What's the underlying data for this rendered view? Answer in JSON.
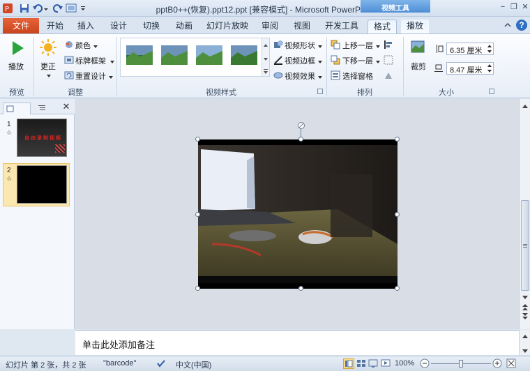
{
  "window": {
    "title": "pptB0++(恢复).ppt12.ppt [兼容模式] - Microsoft PowerPoint",
    "context_tab": "视频工具",
    "minimize": "−",
    "restore": "❐",
    "close": "✕"
  },
  "tabs": {
    "file": "文件",
    "items": [
      "开始",
      "插入",
      "设计",
      "切换",
      "动画",
      "幻灯片放映",
      "审阅",
      "视图",
      "开发工具",
      "格式",
      "播放"
    ],
    "help": "?"
  },
  "ribbon": {
    "preview": {
      "play": "播放",
      "label": "预览"
    },
    "adjust": {
      "correct": "更正",
      "color": "颜色",
      "poster": "标牌框架",
      "reset": "重置设计",
      "label": "调整"
    },
    "video_styles": {
      "shape": "视频形状",
      "border": "视频边框",
      "effects": "视频效果",
      "label": "视频样式"
    },
    "arrange": {
      "bring_forward": "上移一层",
      "send_backward": "下移一层",
      "selection_pane": "选择窗格",
      "label": "排列"
    },
    "size": {
      "crop": "裁剪",
      "height": "6.35 厘米",
      "width": "8.47 厘米",
      "label": "大小"
    }
  },
  "slides_panel": {
    "slide1_num": "1",
    "slide2_num": "2",
    "slide1_text": "自 由 录 制 视 频",
    "star": "☆"
  },
  "notes": {
    "placeholder": "单击此处添加备注"
  },
  "status": {
    "slide_info": "幻灯片 第 2 张，共 2 张",
    "theme": "\"barcode\"",
    "language": "中文(中国)",
    "zoom": "100%"
  }
}
